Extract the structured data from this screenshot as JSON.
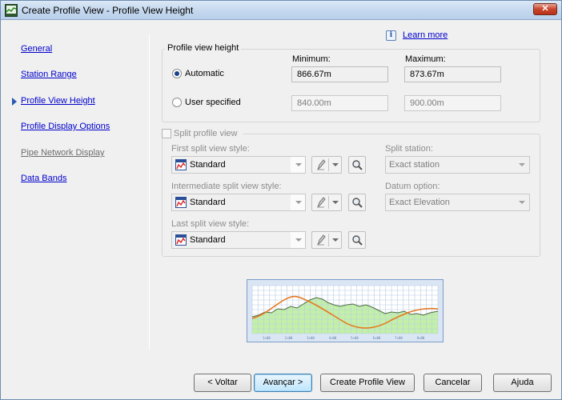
{
  "window": {
    "title": "Create Profile View - Profile View Height",
    "close_glyph": "✕"
  },
  "nav": {
    "items": [
      {
        "label": "General",
        "state": "link"
      },
      {
        "label": "Station Range",
        "state": "link"
      },
      {
        "label": "Profile View Height",
        "state": "current"
      },
      {
        "label": "Profile Display Options",
        "state": "link"
      },
      {
        "label": "Pipe Network Display",
        "state": "disabled"
      },
      {
        "label": "Data Bands",
        "state": "link"
      }
    ]
  },
  "help": {
    "info_glyph": "i",
    "learn_more": "Learn more"
  },
  "height": {
    "legend": "Profile view height",
    "minimum_label": "Minimum:",
    "maximum_label": "Maximum:",
    "automatic_label": "Automatic",
    "user_label": "User specified",
    "auto_min": "866.67m",
    "auto_max": "873.67m",
    "user_min": "840.00m",
    "user_max": "900.00m",
    "selected": "automatic"
  },
  "split": {
    "checkbox_label": "Split profile view",
    "checked": false,
    "first_label": "First split view style:",
    "first_value": "Standard",
    "intermediate_label": "Intermediate split view style:",
    "intermediate_value": "Standard",
    "last_label": "Last split view style:",
    "last_value": "Standard",
    "station_label": "Split station:",
    "station_value": "Exact station",
    "datum_label": "Datum option:",
    "datum_value": "Exact Elevation"
  },
  "preview": {
    "station_labels": [
      "1+00",
      "2+00",
      "3+00",
      "4+00",
      "5+00",
      "6+00",
      "7+00",
      "8+00"
    ],
    "colors": {
      "ground_fill": "#c3f0a8",
      "ground_line": "#4f6b43",
      "profile_line": "#e8781e",
      "grid": "#b7cbe3"
    }
  },
  "buttons": {
    "back": "< Voltar",
    "next": "Avançar >",
    "create": "Create Profile View",
    "cancel": "Cancelar",
    "help": "Ajuda"
  }
}
